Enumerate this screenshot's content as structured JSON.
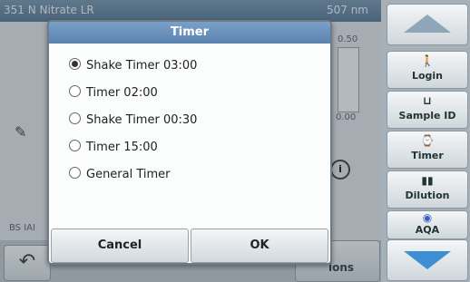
{
  "background": {
    "header_left": "351 N Nitrate LR",
    "header_right": "507 nm",
    "scale_top": "0.50",
    "scale_bottom": "0.00",
    "left_label": "BS IAI",
    "options_label": "ions"
  },
  "right_panel": {
    "buttons": [
      {
        "label": "Login",
        "icon": "person-icon"
      },
      {
        "label": "Sample ID",
        "icon": "beaker-icon"
      },
      {
        "label": "Timer",
        "icon": "timer-icon"
      },
      {
        "label": "Dilution",
        "icon": "dilution-icon"
      },
      {
        "label": "AQA",
        "icon": "aqa-icon"
      }
    ]
  },
  "dialog": {
    "title": "Timer",
    "options": [
      {
        "label": "Shake Timer 03:00",
        "selected": true
      },
      {
        "label": "Timer 02:00",
        "selected": false
      },
      {
        "label": "Shake Timer 00:30",
        "selected": false
      },
      {
        "label": "Timer 15:00",
        "selected": false
      },
      {
        "label": "General Timer",
        "selected": false
      }
    ],
    "cancel_label": "Cancel",
    "ok_label": "OK"
  },
  "colors": {
    "title_bar": "#5a83b0",
    "down_arrow": "#3e8ed3"
  }
}
